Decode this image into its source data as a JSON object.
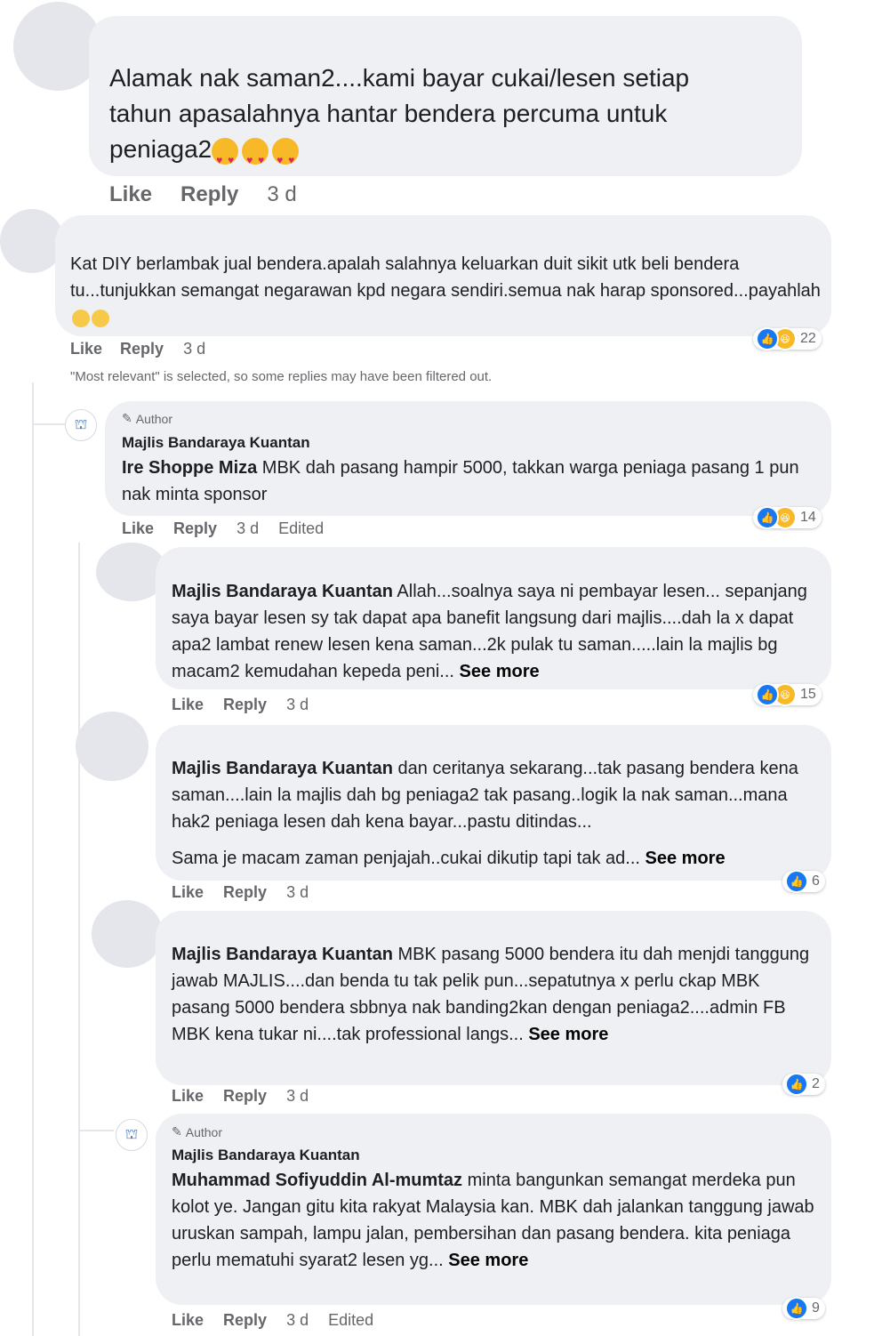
{
  "actions": {
    "like": "Like",
    "reply": "Reply",
    "time": "3 d",
    "edited": "Edited",
    "see_more": "See more"
  },
  "author_label": "Author",
  "filter_note": "\"Most relevant\" is selected, so some replies may have been filtered out.",
  "comments": [
    {
      "text": "Alamak nak saman2....kami bayar cukai/lesen setiap tahun apasalahnya hantar bendera percuma untuk peniaga2"
    },
    {
      "text": "Kat DIY berlambak jual bendera.apalah salahnya keluarkan duit sikit utk beli bendera tu...tunjukkan semangat negarawan kpd negara sendiri.semua nak harap sponsored...payahlah",
      "reactions": "22"
    },
    {
      "author": "Majlis Bandaraya Kuantan",
      "mention": "Ire Shoppe Miza",
      "text": " MBK dah pasang hampir 5000, takkan warga peniaga pasang 1 pun nak minta sponsor",
      "reactions": "14"
    },
    {
      "mention": "Majlis Bandaraya Kuantan",
      "text": " Allah...soalnya saya ni pembayar lesen... sepanjang saya bayar lesen sy tak dapat apa banefit langsung dari majlis....dah la x dapat apa2 lambat renew lesen kena saman...2k pulak tu saman.....lain la majlis bg macam2 kemudahan kepeda peni...",
      "reactions": "15"
    },
    {
      "mention": "Majlis Bandaraya Kuantan",
      "text": " dan ceritanya sekarang...tak pasang bendera kena saman....lain la majlis dah bg peniaga2 tak pasang..logik la nak saman...mana hak2 peniaga lesen dah kena bayar...pastu ditindas...",
      "text2": "Sama je macam zaman penjajah..cukai dikutip tapi tak ad...",
      "reactions": "6"
    },
    {
      "mention": "Majlis Bandaraya Kuantan",
      "text": " MBK pasang 5000 bendera itu dah menjdi tanggung jawab MAJLIS....dan benda tu tak pelik pun...sepatutnya x perlu ckap MBK pasang 5000 bendera sbbnya nak banding2kan dengan peniaga2....admin FB MBK kena tukar ni....tak professional langs...",
      "reactions": "2"
    },
    {
      "author": "Majlis Bandaraya Kuantan",
      "mention": "Muhammad Sofiyuddin Al-mumtaz",
      "text": " minta bangunkan semangat merdeka pun kolot ye. Jangan gitu kita rakyat Malaysia kan. MBK dah jalankan tanggung jawab uruskan sampah, lampu jalan, pembersihan dan pasang bendera. kita peniaga perlu mematuhi syarat2 lesen yg...",
      "reactions": "9"
    }
  ]
}
